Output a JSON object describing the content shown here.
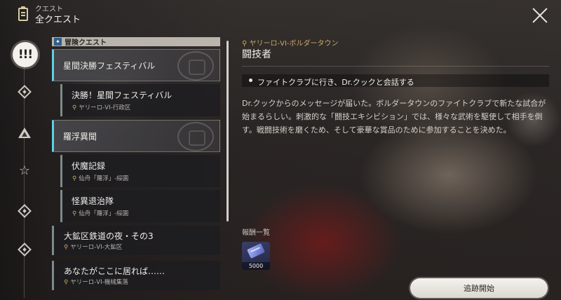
{
  "header": {
    "subtitle": "クエスト",
    "title": "全クエスト"
  },
  "sidebar": {
    "active_label": "!!!",
    "items": [
      "quest-type-diamond",
      "quest-type-triangle",
      "quest-type-star",
      "quest-type-diamond-2",
      "quest-type-diamond-3"
    ]
  },
  "quest_list": {
    "section_label": "冒険クエスト",
    "categories": [
      {
        "label": "星間決勝フェスティバル"
      },
      {
        "label": "羅浮異聞"
      }
    ],
    "items": [
      {
        "title": "決勝！星間フェスティバル",
        "location": "ヤリーロ-VI-行政区"
      },
      {
        "title": "伏魔記録",
        "location": "仙舟「羅浮」-綏園"
      },
      {
        "title": "怪異退治隊",
        "location": "仙舟「羅浮」-綏園"
      },
      {
        "title": "大鉱区鉄道の夜・その3",
        "location": "ヤリーロ-VI-大鉱区"
      },
      {
        "title": "あなたがここに居れば……",
        "location": "ヤリーロ-VI-機械集落"
      }
    ]
  },
  "detail": {
    "location": "ヤリーロ-VI-ボルダータウン",
    "title": "闘技者",
    "objective": "ファイトクラブに行き、Dr.クックと会話する",
    "description": "Dr.クックからのメッセージが届いた。ボルダータウンのファイトクラブで新たな試合が始まるらしい。刺激的な「闘技エキシビション」では、様々な武術を駆使して相手を倒す。戦闘技術を磨くため、そして豪華な賞品のために参加することを決めた。",
    "reward_label": "報酬一覧",
    "reward_count": "5000",
    "track_button": "追跡開始"
  },
  "colors": {
    "accent_cyan": "#5cd0e6",
    "location_gold": "#c9a964"
  }
}
